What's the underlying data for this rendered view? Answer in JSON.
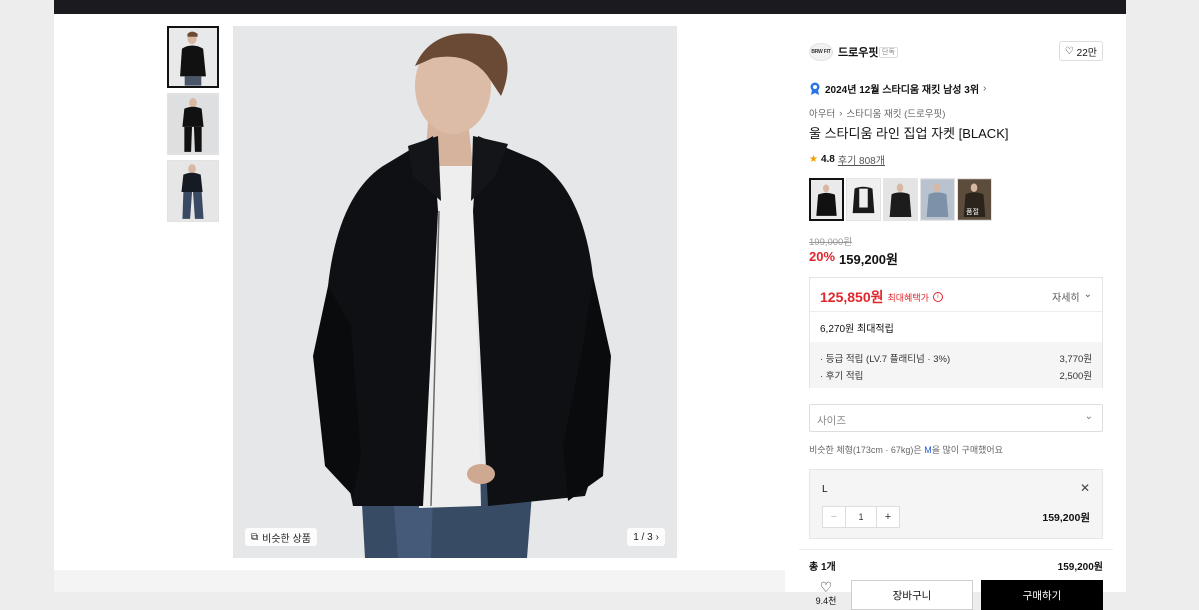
{
  "gallery": {
    "similar_label": "비슷한 상품",
    "counter": "1 / 3"
  },
  "bottom_strip_text": "...",
  "brand": {
    "logo_text": "BRW FIT",
    "name": "드로우핏",
    "tag": "단독",
    "likes": "22만"
  },
  "rank": {
    "text": "2024년 12월 스타디움 재킷 남성 3위"
  },
  "breadcrumb": {
    "level1": "아우터",
    "level2": "스타디움 재킷 (드로우핏)"
  },
  "product": {
    "title": "울 스타디움 라인 집업 자켓 [BLACK]",
    "rating": "4.8",
    "reviews": "후기 808개",
    "color_tag": "품절",
    "original_price": "199,000원",
    "discount": "20%",
    "price": "159,200원"
  },
  "benefit": {
    "max_price": "125,850원",
    "max_label": "최대혜택가",
    "detail_label": "자세히",
    "points": "6,270원 최대적립",
    "rows": [
      {
        "label": "· 등급 적립 (LV.7 플래티넘 · 3%)",
        "value": "3,770원"
      },
      {
        "label": "· 후기 적립",
        "value": "2,500원"
      }
    ]
  },
  "size": {
    "placeholder": "사이즈",
    "hint_prefix": "비슷한 체형(173cm · 67kg)은 ",
    "hint_size": "M",
    "hint_suffix": "을 많이 구매했어요"
  },
  "option": {
    "size": "L",
    "qty": "1",
    "price": "159,200원"
  },
  "total": {
    "label": "총 1개",
    "price": "159,200원"
  },
  "actions": {
    "fav_count": "9.4천",
    "cart": "장바구니",
    "buy": "구매하기"
  }
}
